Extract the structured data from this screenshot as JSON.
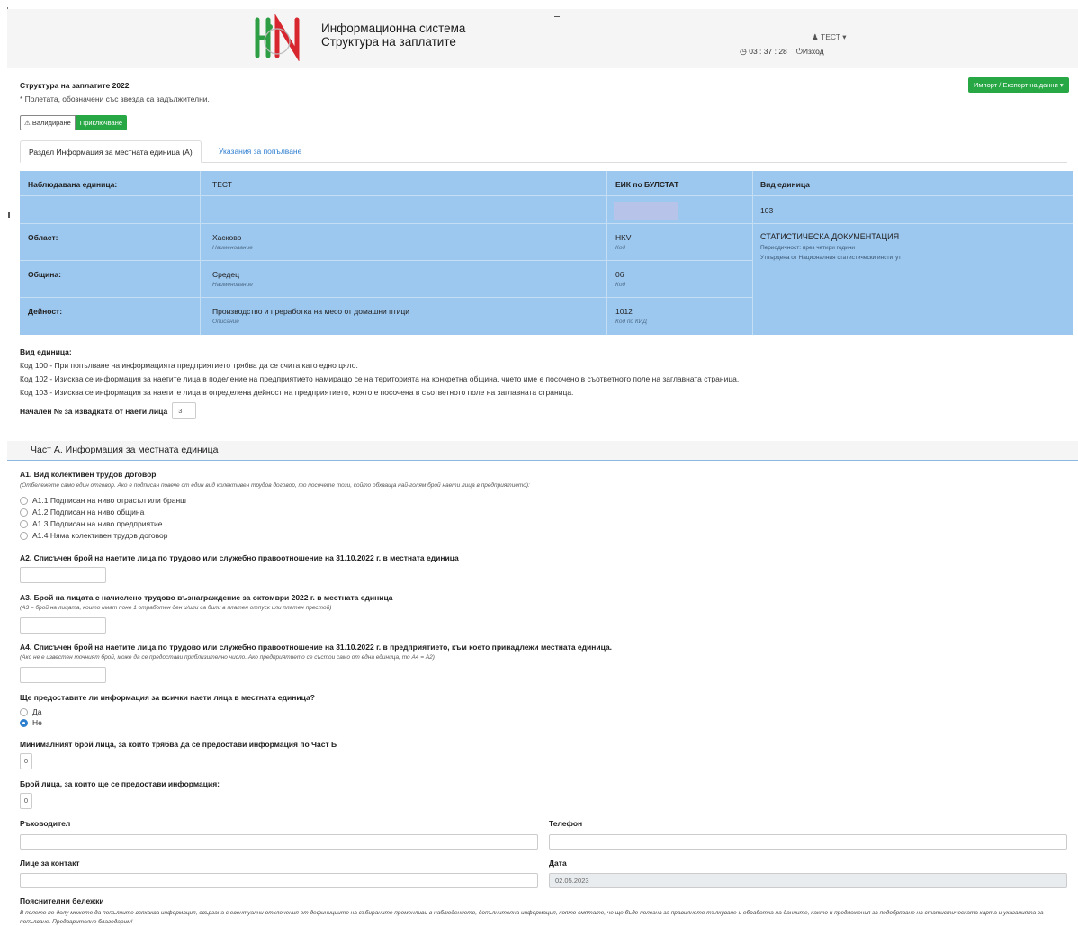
{
  "header": {
    "system_title_line1": "Информационна система",
    "system_title_line2": "Структура на заплатите",
    "user_name": "ТЕСТ",
    "clock": "03 : 37 : 28",
    "logout_label": "Изход",
    "brand_green": "#2e9e45",
    "brand_red": "#d8262e"
  },
  "page": {
    "title": "Структура на заплатите 2022",
    "required_note": "* Полетата, обозначени със звезда са задължителни.",
    "import_export_label": "Импорт / Експорт на данни",
    "validate_label": "Валидиране",
    "finish_label": "Приключване"
  },
  "tabs": [
    {
      "label": "Раздел Информация за местната единица (А)",
      "active": true
    },
    {
      "label": "Указания за попълване",
      "active": false
    }
  ],
  "info": {
    "observed_unit_label": "Наблюдавана единица:",
    "observed_unit_value": "ТЕСТ",
    "eik_label": "ЕИК по БУЛСТАТ",
    "unit_type_label": "Вид единица",
    "unit_type_value": "103",
    "region_label": "Област:",
    "region_value": "Хасково",
    "region_sub": "Наименование",
    "region_code": "HKV",
    "region_code_sub": "Код",
    "municipality_label": "Община:",
    "municipality_value": "Средец",
    "municipality_sub": "Наименование",
    "municipality_code": "06",
    "municipality_code_sub": "Код",
    "activity_label": "Дейност:",
    "activity_value": "Производство и преработка на месо от домашни птици",
    "activity_sub": "Описание",
    "activity_code": "1012",
    "activity_code_sub": "Код по КИД",
    "stat_doc": "СТАТИСТИЧЕСКА ДОКУМЕНТАЦИЯ",
    "stat_period": "Периодичност: през четири години",
    "stat_approved": "Утвърдена от Националния статистически институт",
    "table_color": "#9cc7ef"
  },
  "legend": {
    "title": "Вид единица:",
    "lines": [
      "Код 100 - При попълване на информацията предприятието трябва да се счита като едно цяло.",
      "Код 102 - Изисква се информация за наетите лица в поделение на предприятието намиращо се на територията на конкретна община, чието име е посочено в съответното поле на заглавната страница.",
      "Код 103 - Изисква се информация за наетите лица в определена дейност на предприятието, която е посочена в съответното поле на заглавната страница."
    ]
  },
  "start_no": {
    "label": "Начален № за извадката от наети лица",
    "value": "3"
  },
  "part_a": {
    "title": "Част А. Информация за местната единица",
    "a1_title": "А1. Вид колективен трудов договор",
    "a1_note": "(Отбележете само един отговор. Ако е подписан повече от един вид колективен трудов договор, то посочете този, който обхваща най-голям брой наети лица в предприятието):",
    "a1_options": [
      "А1.1 Подписан на ниво отрасъл или бранш",
      "А1.2 Подписан на ниво община",
      "А1.3 Подписан на ниво предприятие",
      "А1.4 Няма колективен трудов договор"
    ],
    "a2_title": "А2. Списъчен брой на наетите лица по трудово или служебно правоотношение на 31.10.2022 г. в местната единица",
    "a3_title": "А3. Брой на лицата с начислено трудово възнаграждение за октомври 2022 г. в местната единица",
    "a3_note": "(А3 = брой на лицата, които имат поне 1 отработен ден и/или са били в платен отпуск или платен престой)",
    "a4_title": "А4. Списъчен брой на наетите лица по трудово или служебно правоотношение на 31.10.2022 г. в предприятието, към което принадлежи местната единица.",
    "a4_note": "(Ако не е известен точният брой, може да се предостави приблизително число. Ако предприятието се състои само от една единица, то А4 = А2)",
    "all_question": "Ще предоставите ли информация за всички наети лица в местната единица?",
    "yes_label": "Да",
    "no_label": "Не",
    "selected": "Не",
    "min_count_label": "Минималният брой лица, за които трябва да се предостави информация по Част Б",
    "min_count_value": "0",
    "count_label": "Брой лица, за които ще се предостави информация:",
    "count_value": "0",
    "manager_label": "Ръководител",
    "phone_label": "Телефон",
    "contact_label": "Лице за контакт",
    "date_label": "Дата",
    "date_value": "02.05.2023",
    "notes_label": "Пояснителни бележки",
    "notes_text": "В полето по-долу можете да попълните всякаква информация, свързана с евентуални отклонения от дефинициите на събираните променливи в наблюдението, допълнителна информация, която смятате, че ще бъде полезна за правилното тълкуване и обработка на данните, както и предложения за подобряване на статистическата карта и указанията за попълване. Предварително благодарим!"
  }
}
